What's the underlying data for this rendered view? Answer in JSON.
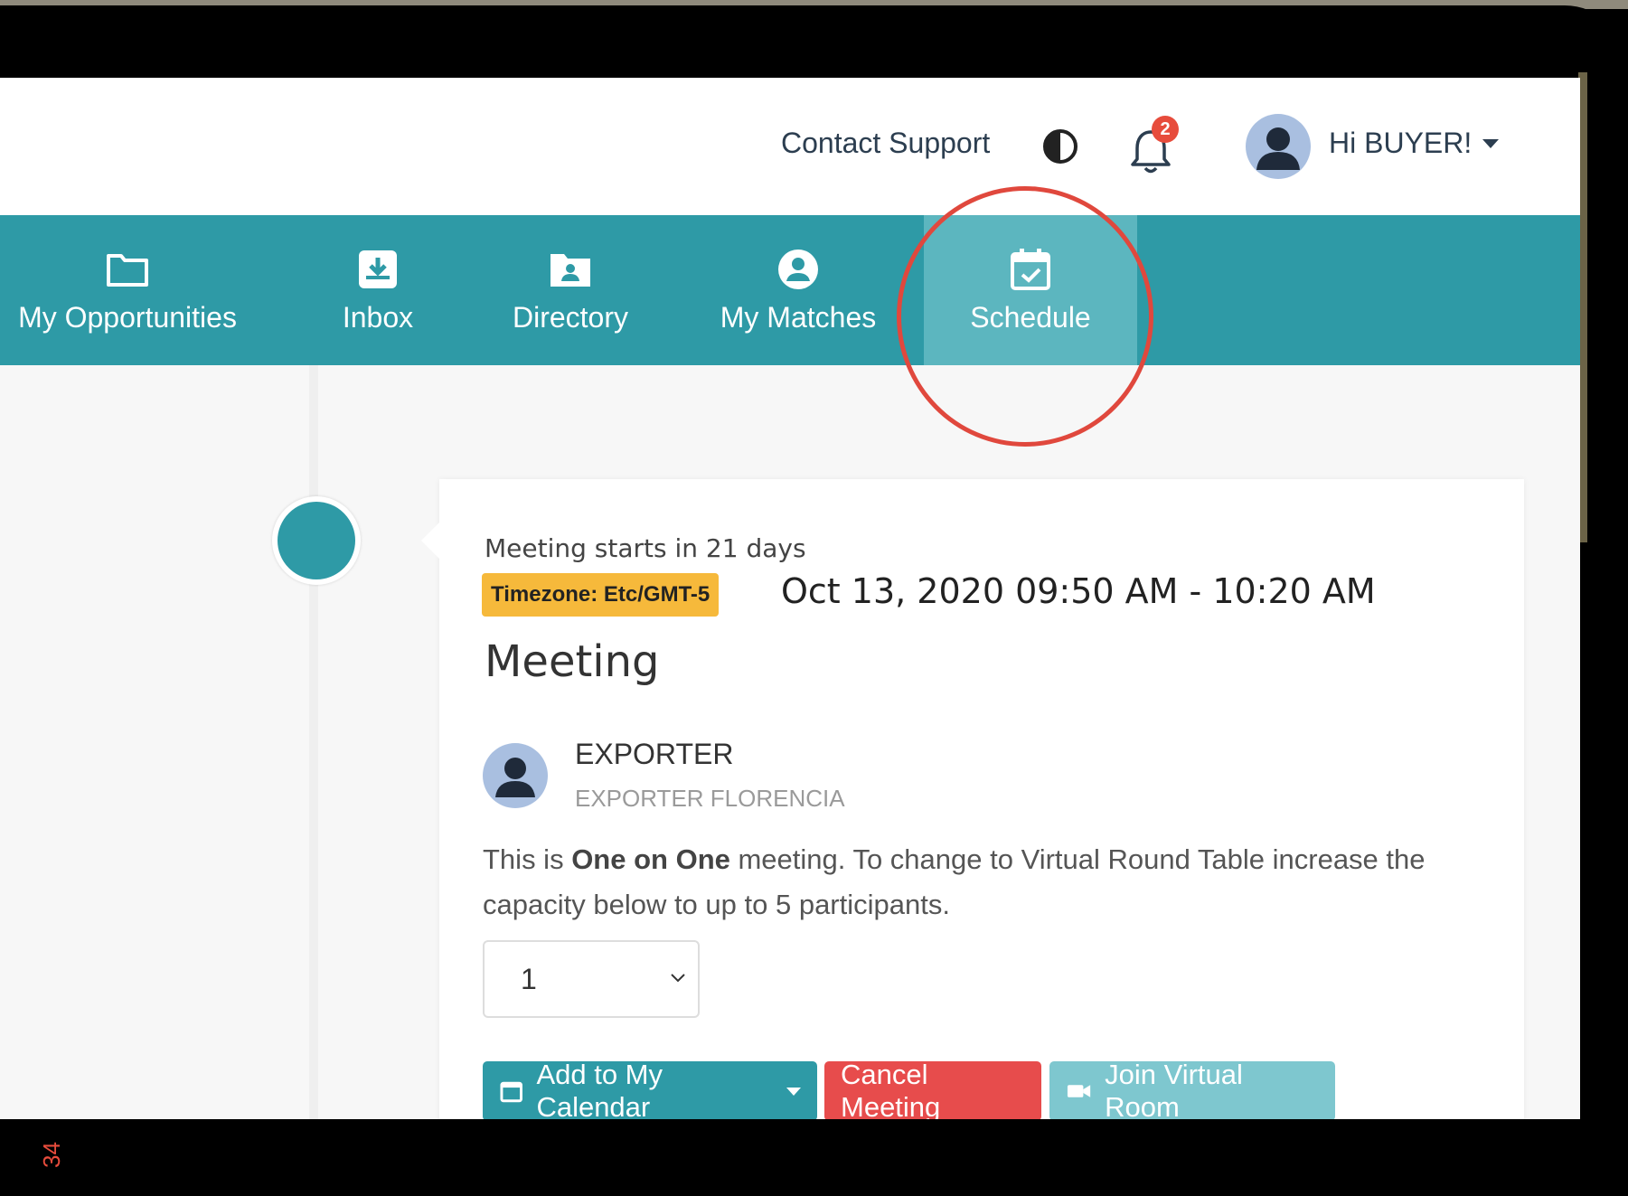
{
  "header": {
    "contact_support": "Contact Support",
    "notification_count": "2",
    "greeting": "Hi BUYER!"
  },
  "nav": {
    "items": [
      {
        "label": "My Opportunities",
        "icon": "folder-icon"
      },
      {
        "label": "Inbox",
        "icon": "inbox-icon"
      },
      {
        "label": "Directory",
        "icon": "directory-icon"
      },
      {
        "label": "My Matches",
        "icon": "user-circle-icon"
      },
      {
        "label": "Schedule",
        "icon": "calendar-check-icon",
        "active": true
      }
    ]
  },
  "meeting": {
    "starts_in": "Meeting starts in 21 days",
    "timezone_badge": "Timezone: Etc/GMT-5",
    "date_range": "Oct 13, 2020 09:50 AM - 10:20 AM",
    "title": "Meeting",
    "participant_name": "EXPORTER",
    "participant_company": "EXPORTER FLORENCIA",
    "desc_prefix": "This is ",
    "desc_bold": "One on One",
    "desc_suffix": " meeting. To change to Virtual Round Table increase the capacity below to up to 5 participants.",
    "capacity_value": "1"
  },
  "actions": {
    "add_calendar": "Add to My Calendar",
    "cancel": "Cancel Meeting",
    "join": "Join Virtual Room"
  },
  "colors": {
    "nav_bg": "#2e9aa6",
    "nav_active": "#5cb6bf",
    "highlight": "#e0483d",
    "badge": "#f6b93b",
    "danger": "#e74c4c"
  },
  "side_label": "34"
}
